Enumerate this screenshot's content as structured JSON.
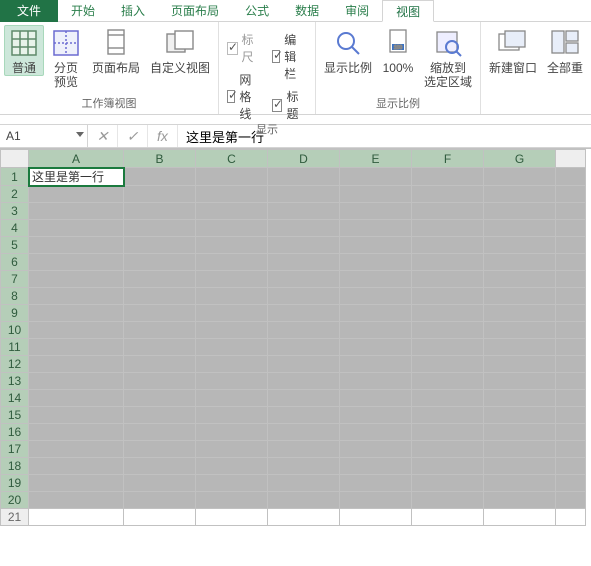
{
  "tabs": {
    "file": "文件",
    "items": [
      "开始",
      "插入",
      "页面布局",
      "公式",
      "数据",
      "审阅",
      "视图"
    ],
    "activeIndex": 6
  },
  "ribbon": {
    "workbookViews": {
      "label": "工作簿视图",
      "normal": "普通",
      "pageBreak": "分页\n预览",
      "pageLayout": "页面布局",
      "custom": "自定义视图"
    },
    "show": {
      "label": "显示",
      "ruler": "标尺",
      "gridlines": "网格线",
      "formulaBar": "编辑栏",
      "headings": "标题"
    },
    "zoom": {
      "label": "显示比例",
      "zoom": "显示比例",
      "hundred": "100%",
      "toSelection": "缩放到\n选定区域"
    },
    "window": {
      "newWindow": "新建窗口",
      "arrangeAll": "全部重"
    }
  },
  "formulaBar": {
    "nameBox": "A1",
    "fx": "fx",
    "value": "这里是第一行"
  },
  "sheet": {
    "columns": [
      "A",
      "B",
      "C",
      "D",
      "E",
      "F",
      "G"
    ],
    "rows": [
      1,
      2,
      3,
      4,
      5,
      6,
      7,
      8,
      9,
      10,
      11,
      12,
      13,
      14,
      15,
      16,
      17,
      18,
      19,
      20,
      21
    ],
    "selectedRowMax": 20,
    "a1": "这里是第一行"
  }
}
